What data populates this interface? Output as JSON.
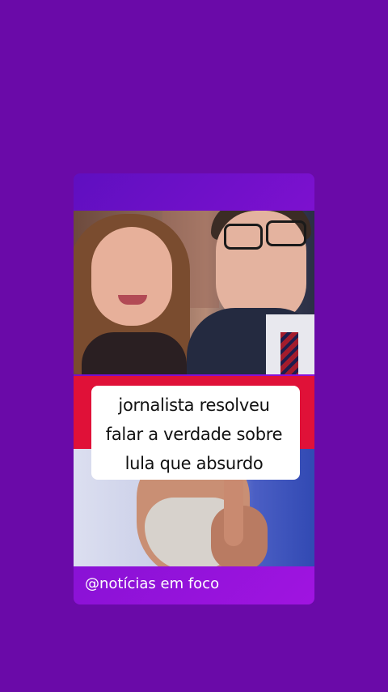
{
  "post": {
    "caption_lines": [
      "jornalista resolveu",
      "falar a verdade sobre",
      "lula que absurdo"
    ],
    "watermark": "@notícias em foco"
  },
  "colors": {
    "background": "#6a0aa8",
    "card_gradient_start": "#5f0fc0",
    "card_gradient_end": "#a014e0",
    "red_band": "#e01138",
    "caption_bg": "#ffffff"
  }
}
